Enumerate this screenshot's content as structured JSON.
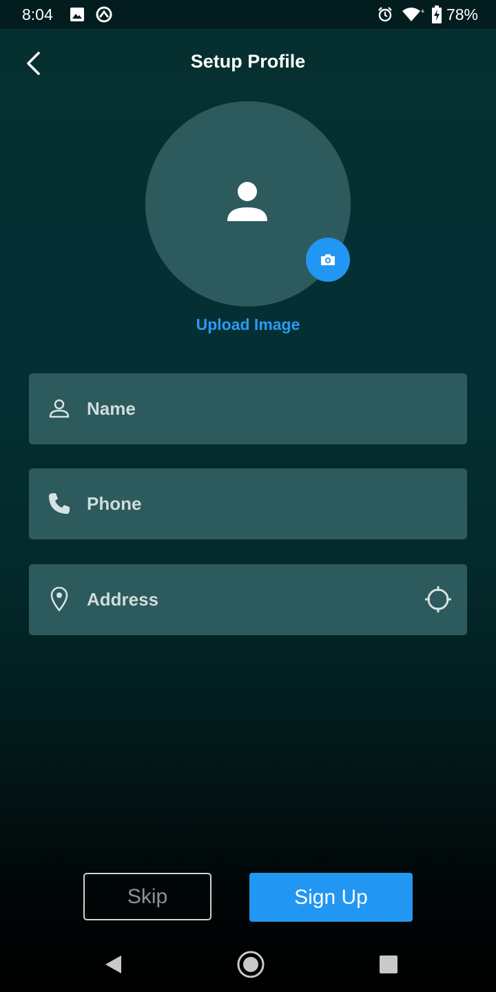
{
  "status_bar": {
    "time": "8:04",
    "battery_percent": "78%",
    "icons": [
      "image-icon",
      "sync-icon",
      "alarm-icon",
      "wifi-icon",
      "battery-charging-icon"
    ]
  },
  "header": {
    "title": "Setup Profile",
    "back_icon": "chevron-left-icon"
  },
  "profile": {
    "avatar_icon": "person-icon",
    "camera_icon": "camera-icon",
    "upload_label": "Upload Image"
  },
  "form": {
    "name": {
      "placeholder": "Name",
      "icon": "person-outline-icon"
    },
    "phone": {
      "placeholder": "Phone",
      "icon": "phone-icon"
    },
    "address": {
      "placeholder": "Address",
      "icon": "location-pin-icon",
      "trailing_icon": "gps-crosshair-icon"
    }
  },
  "actions": {
    "skip_label": "Skip",
    "signup_label": "Sign Up"
  },
  "colors": {
    "accent": "#2196f3",
    "field_bg": "#2d5a5c",
    "background_top": "#07302f",
    "background_bottom": "#000000"
  },
  "nav_bar": {
    "icons": [
      "back-triangle-icon",
      "home-circle-icon",
      "recents-square-icon"
    ]
  }
}
